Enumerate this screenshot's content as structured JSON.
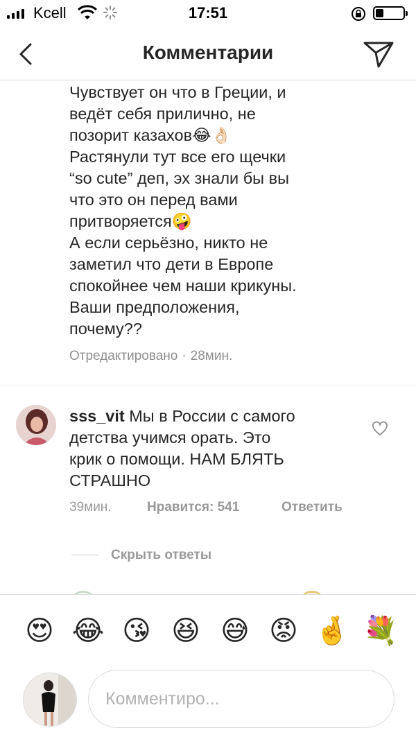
{
  "status_bar": {
    "carrier": "Kcell",
    "time": "17:51",
    "battery_level": 0.3
  },
  "header": {
    "title": "Комментарии",
    "back_icon": "chevron-left-icon",
    "share_icon": "paper-plane-icon"
  },
  "comment": {
    "lines": [
      "Чувствует он что в Греции, и",
      "ведёт себя прилично, не",
      "позорит казахов😂👌🏻",
      "Растянули тут все его щечки",
      "“so cute” деп, эх знали бы вы",
      "что это он перед вами",
      "притворяется🤪",
      "А если серьёзно, никто не",
      "заметил что дети в Европе",
      "спокойнее чем наши крикуны.",
      "Ваши предположения,",
      "почему??"
    ],
    "edited": "Отредактировано",
    "time": "28мин."
  },
  "reply": {
    "username": "sss_vit",
    "text_lines": [
      " Мы в России с самого",
      "детства учимся орать. Это",
      "крик о помощи. НАМ БЛЯТЬ",
      "СТРАШНО"
    ],
    "time": "39мин.",
    "likes": "Нравится: 541",
    "reply_label": "Ответить",
    "like_icon": "heart-outline-icon"
  },
  "hide_replies": "Скрыть ответы",
  "emoji_bar": [
    "😍",
    "😂",
    "😘",
    "😆",
    "😅",
    "😡",
    "🤞",
    "💐"
  ],
  "composer": {
    "placeholder": "Комментиро..."
  },
  "colors": {
    "text": "#262626",
    "secondary": "#8e8e8e",
    "border": "#dbdbdb"
  }
}
